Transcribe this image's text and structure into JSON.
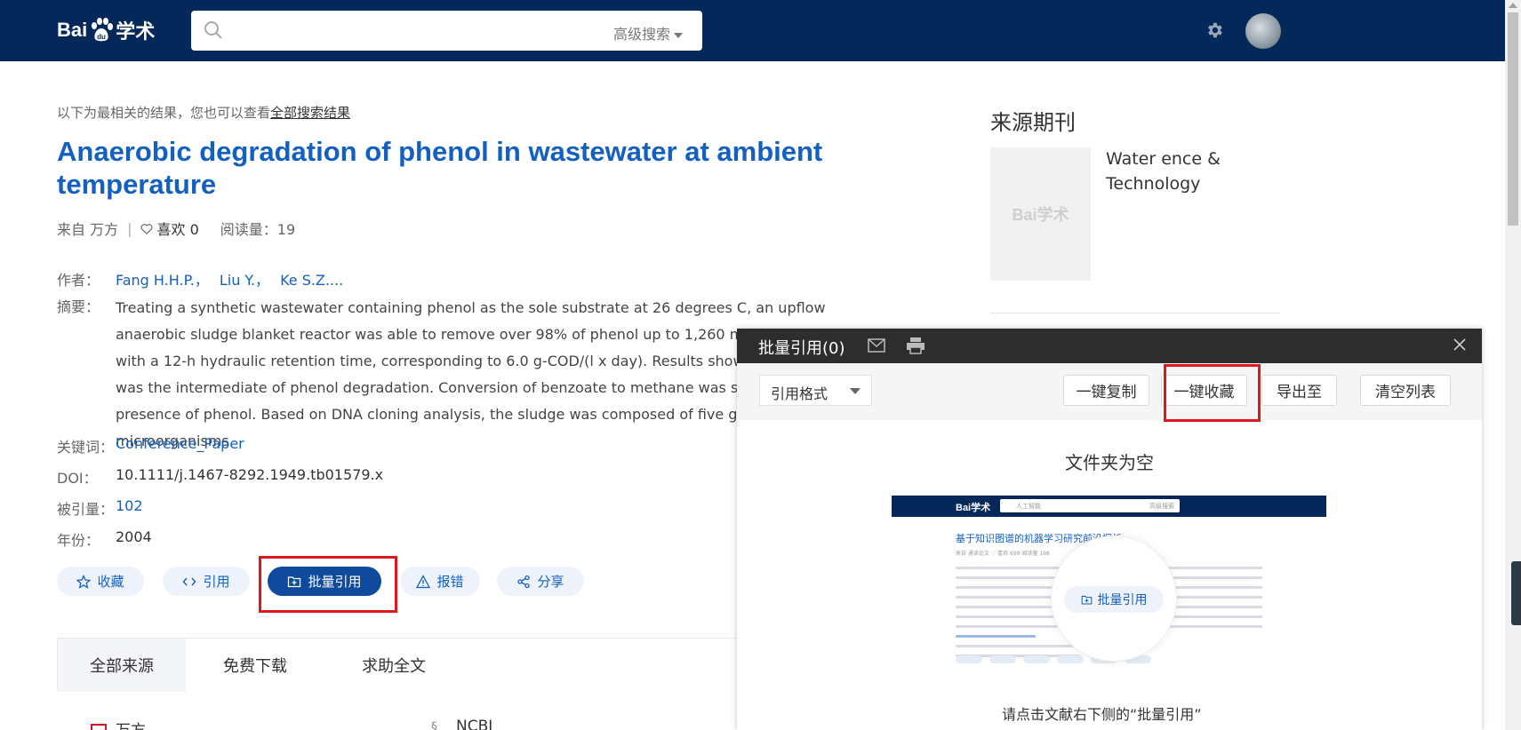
{
  "header": {
    "logo_text_left": "Bai",
    "logo_text_right": "学术",
    "search_placeholder": "",
    "advanced_search": "高级搜索"
  },
  "main": {
    "hint_prefix": "以下为最相关的结果，您也可以查看",
    "hint_link": "全部搜索结果",
    "title": "Anaerobic degradation of phenol in wastewater at ambient temperature",
    "meta": {
      "source": "来自 万方",
      "likes": "喜欢 0",
      "reads": "阅读量：19"
    },
    "authors_label": "作者：",
    "authors": [
      "Fang H.H.P.，",
      "Liu Y.，",
      "Ke S.Z...."
    ],
    "abstract_label": "摘要：",
    "abstract": "Treating a synthetic wastewater containing phenol as the sole substrate at 26 degrees C, an upflow anaerobic sludge blanket reactor was able to remove over 98% of phenol up to 1,260 mg/l in wastewater with a 12-h hydraulic retention time, corresponding to 6.0 g-COD/(l x day). Results showed that benzoate was the intermediate of phenol degradation. Conversion of benzoate to methane was suppressed by the presence of phenol. Based on DNA cloning analysis, the sludge was composed of five groups of microorganisms.",
    "keywords_label": "关键词：",
    "keywords": "Conference_Paper",
    "doi_label": "DOI：",
    "doi": "10.1111/j.1467-8292.1949.tb01579.x",
    "cited_label": "被引量：",
    "cited": "102",
    "year_label": "年份：",
    "year": "2004",
    "actions": {
      "collect": "收藏",
      "cite": "引用",
      "batch_cite": "批量引用",
      "report": "报错",
      "share": "分享"
    },
    "tabs": [
      "全部来源",
      "免费下载",
      "求助全文"
    ],
    "sources": [
      "万方",
      "NCBI"
    ]
  },
  "right": {
    "source_title": "来源期刊",
    "cover_text": "Bai学术",
    "journal_name": "Water ence & Technology"
  },
  "panel": {
    "title": "批量引用(0)",
    "format_select": "引用格式",
    "buttons": {
      "copy": "一键复制",
      "collect": "一键收藏",
      "export": "导出至",
      "clear": "清空列表"
    },
    "empty_title": "文件夹为空",
    "preview": {
      "logo": "Bai学术",
      "search_text": "人工智能",
      "adv": "高级搜索",
      "title": "基于知识图谱的机器学习研究前沿探析",
      "meta": "来自 通读论文    ♡ 喜欢 699    阅读量 198"
    },
    "lens_button": "批量引用",
    "instruction": "请点击文献右下侧的“批量引用”"
  },
  "colors": {
    "header_bg": "#04285a",
    "link_blue": "#1360c1",
    "primary_button": "#0f4a9c",
    "highlight_red": "#e0161d",
    "panel_header": "#2d2d2d"
  }
}
